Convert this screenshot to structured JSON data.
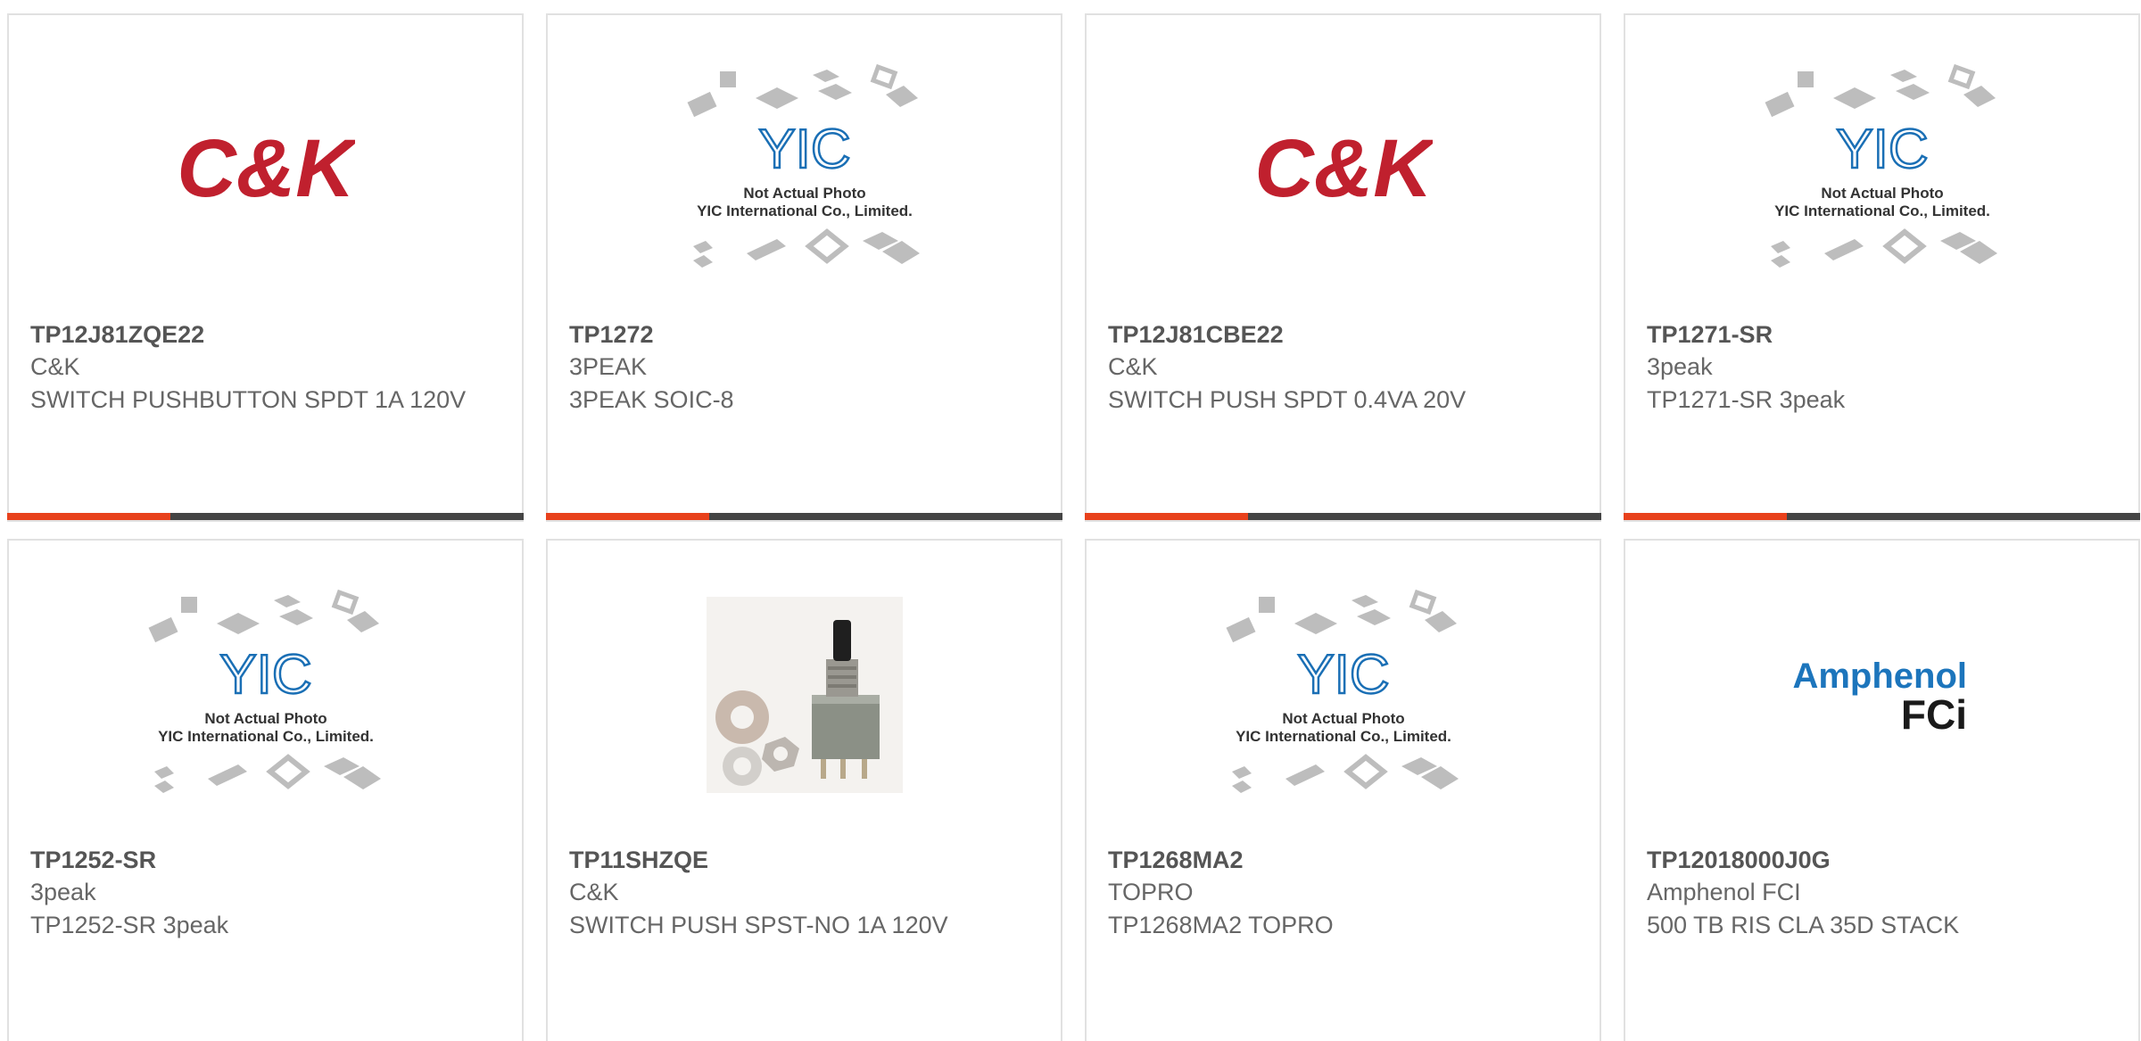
{
  "colors": {
    "accent": "#e8411c",
    "bar": "#444444",
    "border": "#e1e1e1",
    "part_number": "#555555",
    "text": "#666666",
    "ck_red": "#c0202e",
    "yic_blue": "#1a6fb5",
    "amphenol_blue": "#1c75bc"
  },
  "logos": {
    "ck": "C&K",
    "yic_mark": "YIC",
    "yic_line1": "Not Actual Photo",
    "yic_line2": "YIC International Co., Limited.",
    "amphenol_line1": "Amphenol",
    "amphenol_line2": "FCi"
  },
  "products": [
    {
      "part_number": "TP12J81ZQE22",
      "manufacturer": "C&K",
      "description": "SWITCH PUSHBUTTON SPDT 1A 120V",
      "image": "ck-logo"
    },
    {
      "part_number": "TP1272",
      "manufacturer": "3PEAK",
      "description": "3PEAK SOIC-8",
      "image": "yic-placeholder"
    },
    {
      "part_number": "TP12J81CBE22",
      "manufacturer": "C&K",
      "description": "SWITCH PUSH SPDT 0.4VA 20V",
      "image": "ck-logo"
    },
    {
      "part_number": "TP1271-SR",
      "manufacturer": "3peak",
      "description": "TP1271-SR 3peak",
      "image": "yic-placeholder"
    },
    {
      "part_number": "TP1252-SR",
      "manufacturer": "3peak",
      "description": "TP1252-SR 3peak",
      "image": "yic-placeholder"
    },
    {
      "part_number": "TP11SHZQE",
      "manufacturer": "C&K",
      "description": "SWITCH PUSH SPST-NO 1A 120V",
      "image": "switch-photo"
    },
    {
      "part_number": "TP1268MA2",
      "manufacturer": "TOPRO",
      "description": "TP1268MA2 TOPRO",
      "image": "yic-placeholder"
    },
    {
      "part_number": "TP12018000J0G",
      "manufacturer": "Amphenol FCI",
      "description": "500 TB RIS CLA 35D STACK",
      "image": "amphenol-logo"
    }
  ]
}
